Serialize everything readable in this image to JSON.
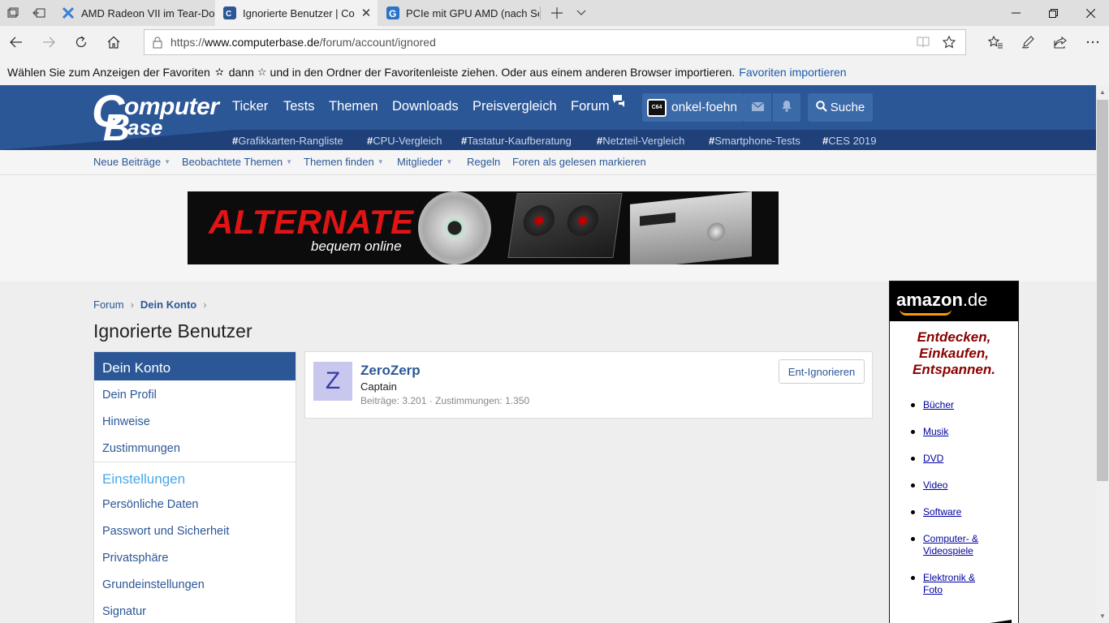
{
  "browser": {
    "tabs": [
      {
        "title": "AMD Radeon VII im Tear-Do",
        "active": false
      },
      {
        "title": "Ignorierte Benutzer | Co",
        "active": true
      },
      {
        "title": "PCIe mit GPU AMD (nach Se",
        "active": false
      }
    ],
    "url_prefix": "https://",
    "url_host": "www.computerbase.de",
    "url_path": "/forum/account/ignored",
    "favorites_bar": {
      "message_part1": "Wählen Sie zum Anzeigen der Favoriten",
      "message_part2": "dann",
      "message_part3": "und in den Ordner der Favoritenleiste ziehen. Oder aus einem anderen Browser importieren.",
      "import_link": "Favoriten importieren"
    }
  },
  "site": {
    "logo": {
      "line1_initial": "C",
      "line1_rest": "omputer",
      "line2_initial": "B",
      "line2_rest": "ase"
    },
    "main_nav": [
      "Ticker",
      "Tests",
      "Themen",
      "Downloads",
      "Preisvergleich",
      "Forum"
    ],
    "username": "onkel-foehn",
    "avatar_text": "C64",
    "search_label": "Suche",
    "tags": [
      "Grafikkarten-Rangliste",
      "CPU-Vergleich",
      "Tastatur-Kaufberatung",
      "Netzteil-Vergleich",
      "Smartphone-Tests",
      "CES 2019"
    ],
    "tag_hash": "#",
    "sub_nav": [
      {
        "label": "Neue Beiträge",
        "has_menu": true
      },
      {
        "label": "Beobachtete Themen",
        "has_menu": true
      },
      {
        "label": "Themen finden",
        "has_menu": true
      },
      {
        "label": "Mitglieder",
        "has_menu": true
      },
      {
        "label": "Regeln",
        "has_menu": false
      },
      {
        "label": "Foren als gelesen markieren",
        "has_menu": false
      }
    ],
    "banner": {
      "brand": "ALTERNATE",
      "tagline": "bequem online"
    }
  },
  "breadcrumb": {
    "root": "Forum",
    "current": "Dein Konto"
  },
  "page_title": "Ignorierte Benutzer",
  "sidebar": {
    "header": "Dein Konto",
    "account_items": [
      "Dein Profil",
      "Hinweise",
      "Zustimmungen"
    ],
    "settings_header": "Einstellungen",
    "settings_items": [
      "Persönliche Daten",
      "Passwort und Sicherheit",
      "Privatsphäre",
      "Grundeinstellungen",
      "Signatur"
    ]
  },
  "ignored_user": {
    "avatar_letter": "Z",
    "name": "ZeroZerp",
    "title": "Captain",
    "stats": "Beiträge: 3.201 · Zustimmungen: 1.350",
    "unignore_label": "Ent-Ignorieren"
  },
  "amazon_ad": {
    "logo_main": "amazon",
    "logo_tld": ".de",
    "slogan": [
      "Entdecken,",
      "Einkaufen,",
      "Entspannen."
    ],
    "links": [
      "Bücher",
      "Musik",
      "DVD",
      "Video",
      "Software",
      "Computer- & Videospiele",
      "Elektronik & Foto"
    ]
  }
}
